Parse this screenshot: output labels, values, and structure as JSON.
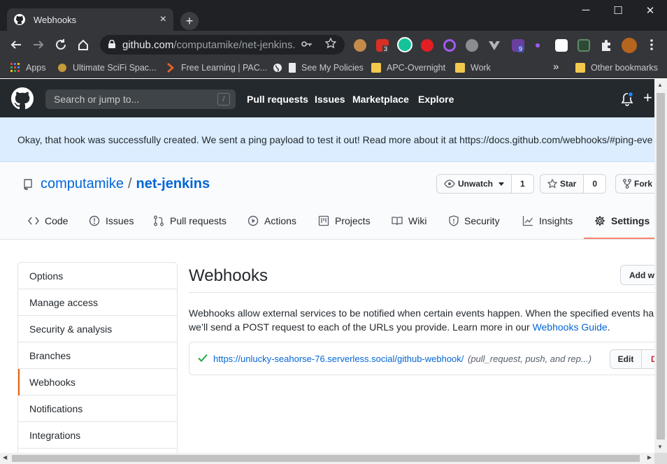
{
  "browser": {
    "tab_title": "Webhooks",
    "tab_close": "×",
    "new_tab": "+",
    "window_controls": {
      "minimize": "─",
      "maximize": "☐",
      "close": "✕"
    },
    "url_host": "github.com",
    "url_path": "/computamike/net-jenkins...",
    "extension_badges": {
      "one": "3",
      "two": "9"
    },
    "bookmarks": [
      {
        "label": "Apps",
        "icon": "apps-grid-icon"
      },
      {
        "label": "Ultimate SciFi Spac...",
        "icon": "globe-icon"
      },
      {
        "label": "Free Learning | PAC...",
        "icon": "packt-icon"
      },
      {
        "label": "",
        "icon": "globe-icon"
      },
      {
        "label": "See My Policies",
        "icon": "page-icon"
      },
      {
        "label": "APC-Overnight",
        "icon": "folder-icon"
      },
      {
        "label": "Work",
        "icon": "folder-icon"
      }
    ],
    "bookmarks_overflow": "»",
    "other_bookmarks": "Other bookmarks"
  },
  "github_header": {
    "search_placeholder": "Search or jump to...",
    "search_shortcut": "/",
    "nav": [
      "Pull requests",
      "Issues",
      "Marketplace",
      "Explore"
    ],
    "plus": "+"
  },
  "flash": {
    "message": "Okay, that hook was successfully created. We sent a ping payload to test it out! Read more about it at https://docs.github.com/webhooks/#ping-eve"
  },
  "repo": {
    "owner": "computamike",
    "separator": "/",
    "name": "net-jenkins",
    "watch_label": "Unwatch",
    "watch_count": "1",
    "star_label": "Star",
    "star_count": "0",
    "fork_label": "Fork",
    "tabs": [
      "Code",
      "Issues",
      "Pull requests",
      "Actions",
      "Projects",
      "Wiki",
      "Security",
      "Insights",
      "Settings"
    ],
    "active_tab": "Settings"
  },
  "settings_menu": {
    "items": [
      "Options",
      "Manage access",
      "Security & analysis",
      "Branches",
      "Webhooks",
      "Notifications",
      "Integrations"
    ],
    "selected": "Webhooks"
  },
  "main": {
    "title": "Webhooks",
    "add_button": "Add webhook",
    "description_line1": "Webhooks allow external services to be notified when certain events happen. When the specified events hap",
    "description_line2": "we’ll send a POST request to each of the URLs you provide. Learn more in our ",
    "description_link": "Webhooks Guide",
    "description_end": ".",
    "hooks": [
      {
        "url": "https://unlucky-seahorse-76.serverless.social/github-webhook/",
        "events": "(pull_request, push, and rep...)",
        "edit_label": "Edit",
        "delete_label": "Delete"
      }
    ]
  },
  "colors": {
    "accent_link": "#0366d6",
    "header_bg": "#24292e",
    "flash_bg": "#dbedff",
    "active_tab_underline": "#f9826c",
    "success_check": "#28a745",
    "danger": "#cb2431"
  }
}
